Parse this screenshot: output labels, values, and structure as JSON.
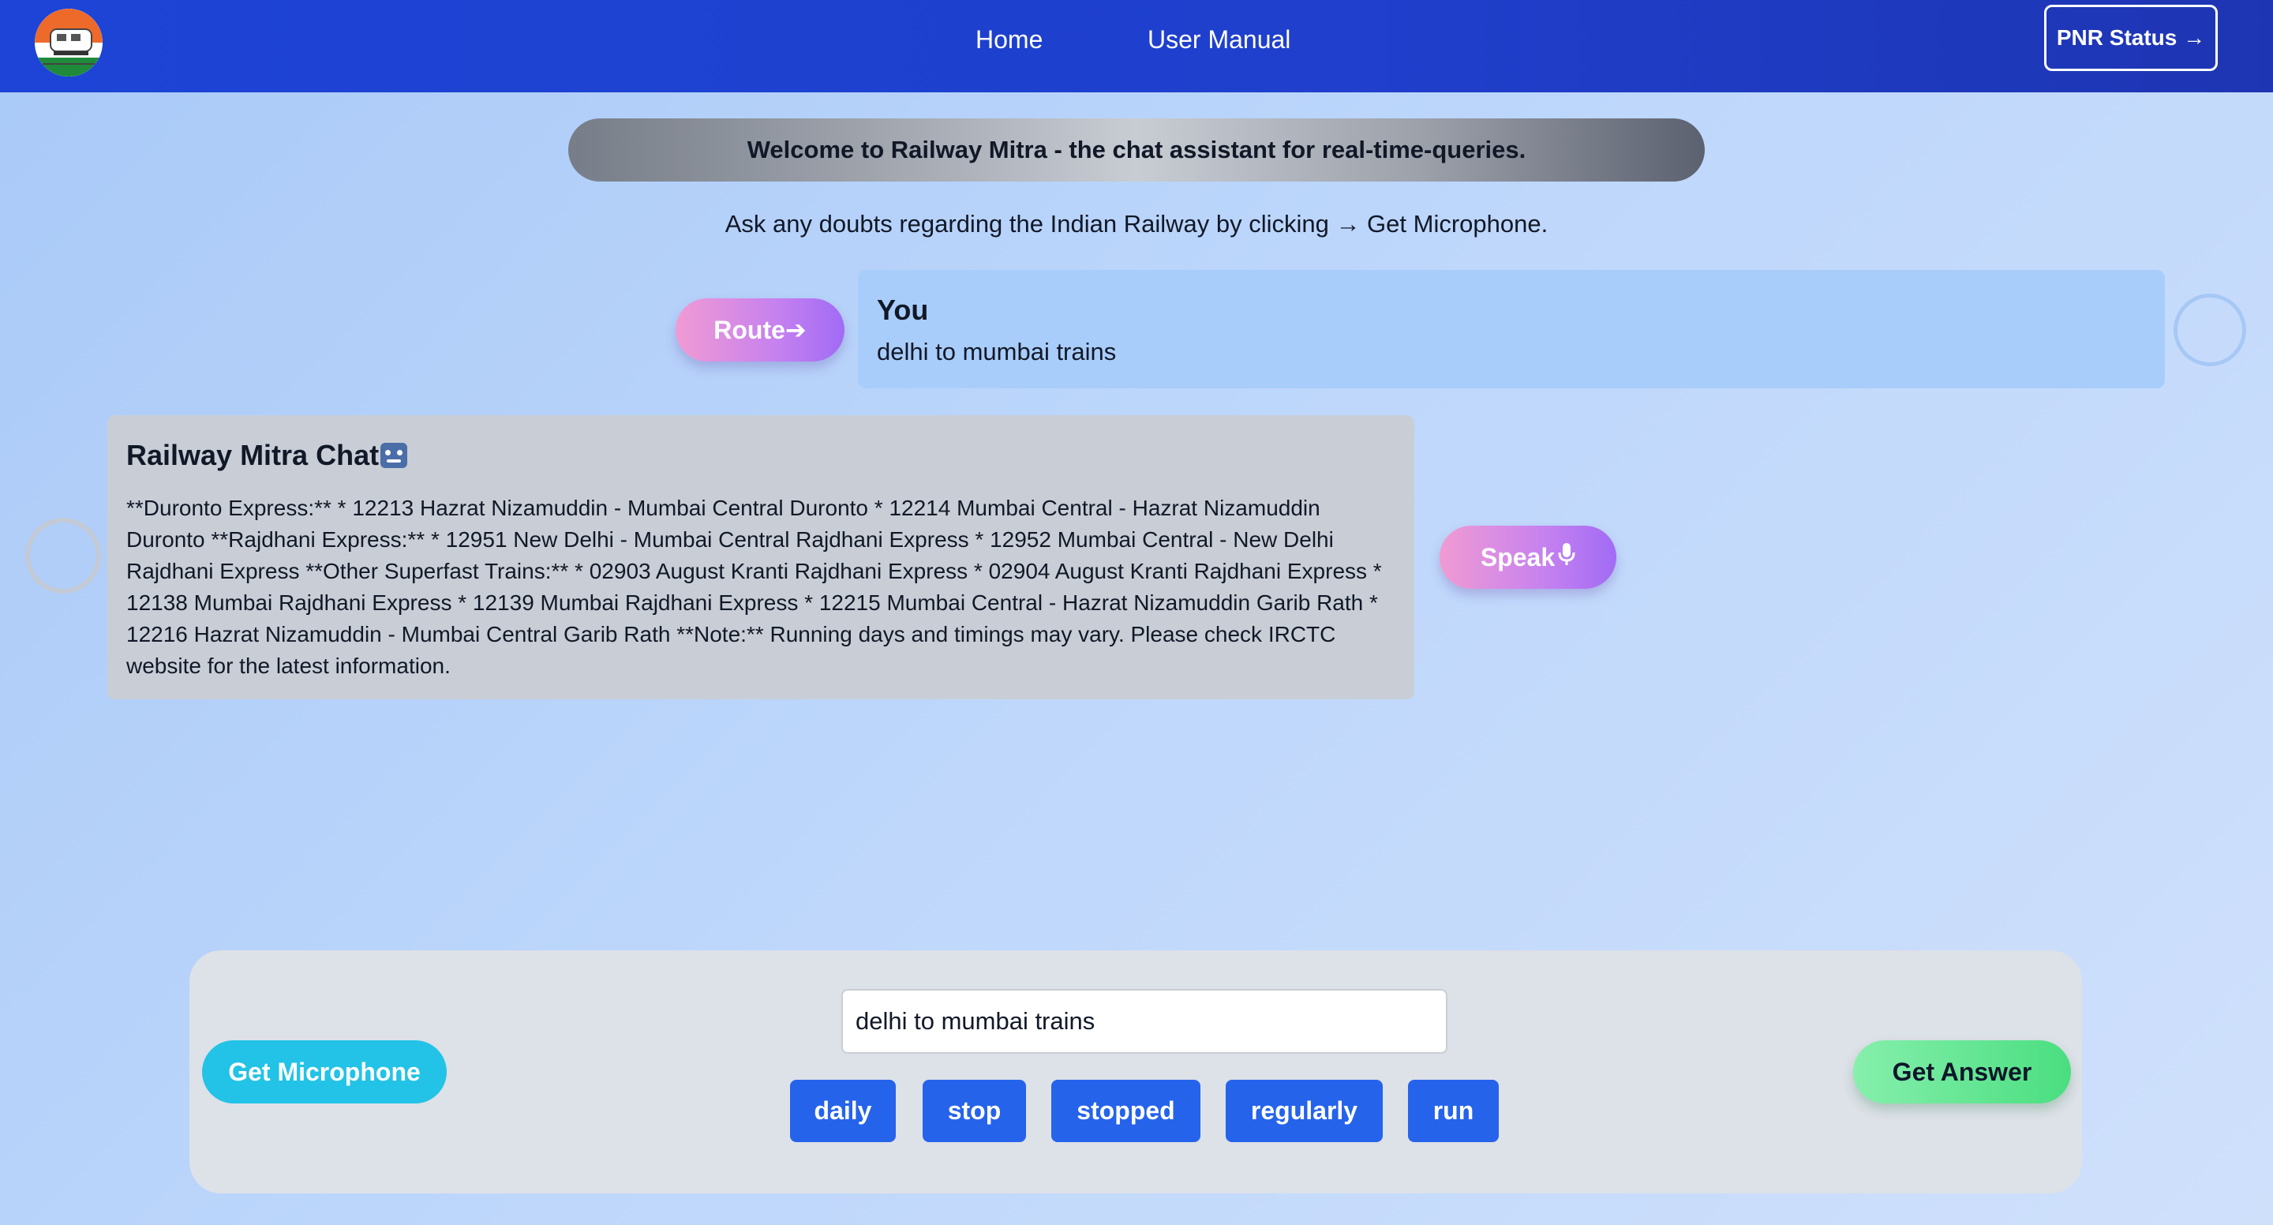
{
  "nav": {
    "home": "Home",
    "user_manual": "User Manual",
    "pnr_status": "PNR Status →"
  },
  "welcome": "Welcome to Railway Mitra - the chat assistant for real-time-queries.",
  "subtitle": "Ask any doubts regarding the Indian Railway by clicking → Get Microphone.",
  "user_message": {
    "button": "Route➔",
    "author": "You",
    "text": "delhi to mumbai trains"
  },
  "bot_message": {
    "title": "Railway Mitra Chat",
    "text": "**Duronto Express:** * 12213 Hazrat Nizamuddin - Mumbai Central Duronto * 12214 Mumbai Central - Hazrat Nizamuddin Duronto **Rajdhani Express:** * 12951 New Delhi - Mumbai Central Rajdhani Express * 12952 Mumbai Central - New Delhi Rajdhani Express **Other Superfast Trains:** * 02903 August Kranti Rajdhani Express * 02904 August Kranti Rajdhani Express * 12138 Mumbai Rajdhani Express * 12139 Mumbai Rajdhani Express * 12215 Mumbai Central - Hazrat Nizamuddin Garib Rath * 12216 Hazrat Nizamuddin - Mumbai Central Garib Rath **Note:** Running days and timings may vary. Please check IRCTC website for the latest information.",
    "speak_button": "Speak"
  },
  "input_panel": {
    "mic_button": "Get Microphone",
    "query_value": "delhi to mumbai trains",
    "answer_button": "Get Answer",
    "suggestions": [
      "daily",
      "stop",
      "stopped",
      "regularly",
      "run"
    ]
  },
  "colors": {
    "header": "#1f3fcc",
    "chip": "#2563eb",
    "mic": "#22c3e6",
    "answer": "#4ade80",
    "user_card": "#a9cdfa",
    "bot_card": "#c9ced6"
  }
}
